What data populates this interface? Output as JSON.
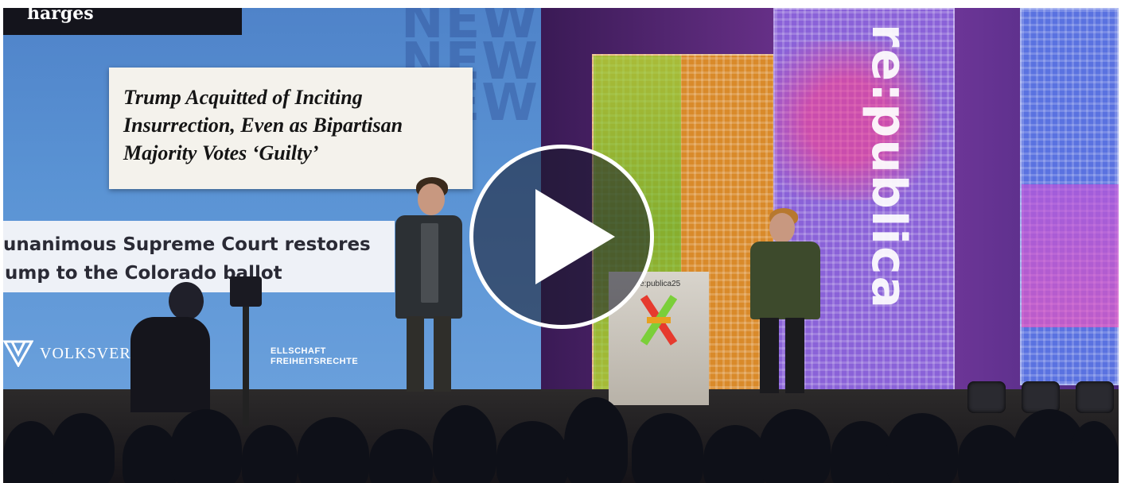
{
  "video": {
    "play_label": "Play video",
    "slide": {
      "top_label": "harges",
      "watermark": [
        "NEW",
        "NEW",
        "NEW"
      ],
      "headline_lines": [
        "Trump Acquitted of Inciting",
        "Insurrection, Even as Bipartisan",
        "Majority Votes ‘Guilty’"
      ],
      "subhead_lines": [
        "unanimous Supreme Court restores",
        "ump to the Colorado ballot"
      ],
      "sponsor_one": "VOLKSVERPF",
      "sponsor_two_lines": [
        "ELLSCHAFT",
        "FREIHEITSRECHTE"
      ]
    },
    "stage": {
      "vertical_brand": "re:publica",
      "lectern_brand": "re:publica25"
    }
  },
  "colors": {
    "screen_blue": "#5a93d4",
    "stage_purple": "#5b2a7a",
    "accent_green": "#8fd640",
    "accent_pink": "#ff3c8a"
  }
}
